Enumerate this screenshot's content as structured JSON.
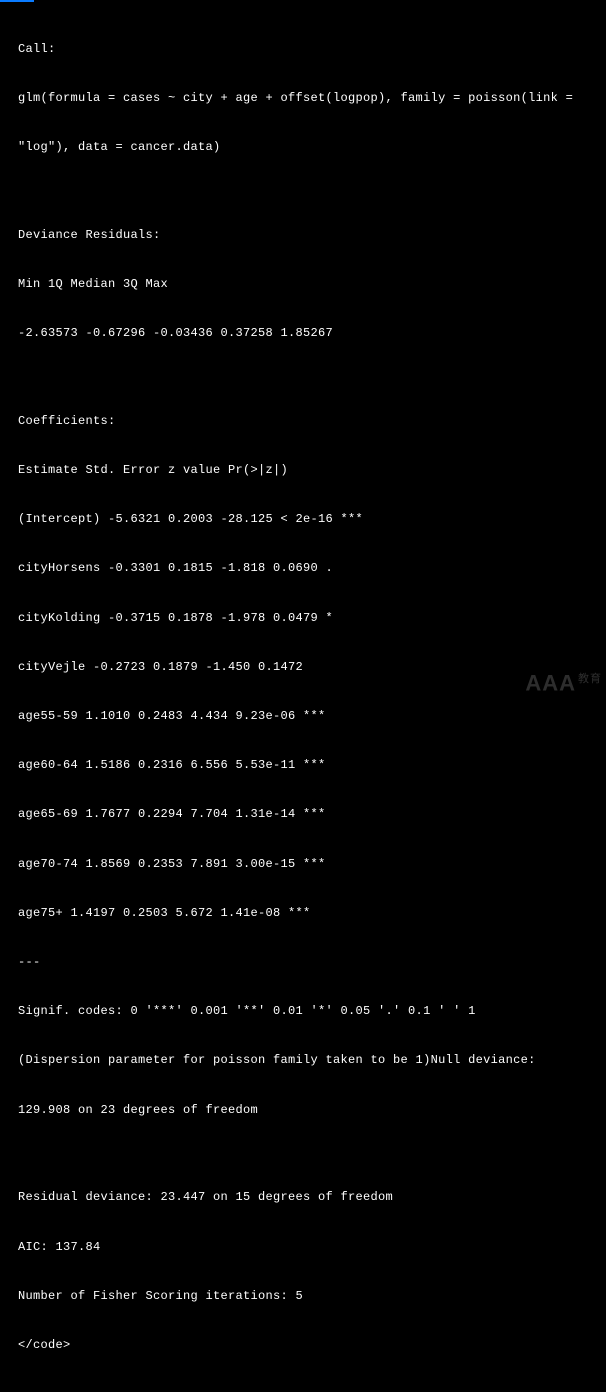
{
  "lines": {
    "l0": "Call:",
    "l1": "glm(formula = cases ~ city + age + offset(logpop), family = poisson(link =",
    "l2": "\"log\"), data = cancer.data)",
    "l3": "Deviance Residuals:",
    "l4": "Min 1Q Median 3Q Max",
    "l5": "-2.63573 -0.67296 -0.03436 0.37258 1.85267",
    "l6": "Coefficients:",
    "l7": "Estimate Std. Error z value Pr(>|z|)",
    "l8": "(Intercept) -5.6321 0.2003 -28.125 < 2e-16 ***",
    "l9": "cityHorsens -0.3301 0.1815 -1.818 0.0690 .",
    "l10": "cityKolding -0.3715 0.1878 -1.978 0.0479 *",
    "l11": "cityVejle -0.2723 0.1879 -1.450 0.1472",
    "l12": "age55-59 1.1010 0.2483 4.434 9.23e-06 ***",
    "l13": "age60-64 1.5186 0.2316 6.556 5.53e-11 ***",
    "l14": "age65-69 1.7677 0.2294 7.704 1.31e-14 ***",
    "l15": "age70-74 1.8569 0.2353 7.891 3.00e-15 ***",
    "l16": "age75+ 1.4197 0.2503 5.672 1.41e-08 ***",
    "l17": "---",
    "l18": "Signif. codes: 0 '***' 0.001 '**' 0.01 '*' 0.05 '.' 0.1 ' ' 1",
    "l19": "(Dispersion parameter for poisson family taken to be 1)Null deviance:",
    "l20": "129.908 on 23 degrees of freedom",
    "l21": "Residual deviance: 23.447 on 15 degrees of freedom",
    "l22": "AIC: 137.84",
    "l23": "Number of Fisher Scoring iterations: 5",
    "l24": "</code>"
  },
  "watermark": {
    "main": "AAA",
    "sub": "教育"
  }
}
